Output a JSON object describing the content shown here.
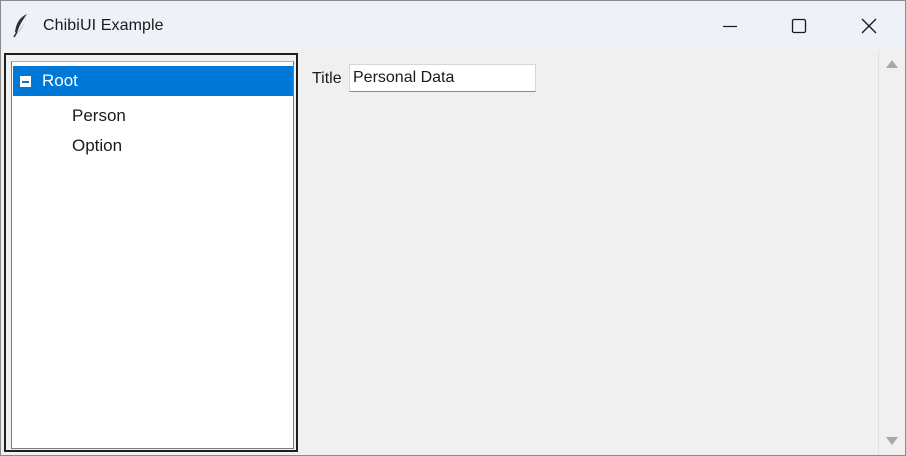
{
  "window": {
    "title": "ChibiUI Example",
    "icon": "feather-icon",
    "controls": {
      "minimize_icon": "minimize-icon",
      "maximize_icon": "maximize-icon",
      "close_icon": "close-icon"
    }
  },
  "tree": {
    "items": [
      {
        "label": "Root",
        "expanded": true,
        "selected": true
      },
      {
        "label": "Person",
        "selected": false
      },
      {
        "label": "Option",
        "selected": false
      }
    ],
    "selection_color": "#0078d7"
  },
  "form": {
    "title_label": "Title",
    "title_value": "Personal Data"
  },
  "scrollbar": {
    "up_icon": "arrow-up-icon",
    "down_icon": "arrow-down-icon"
  }
}
